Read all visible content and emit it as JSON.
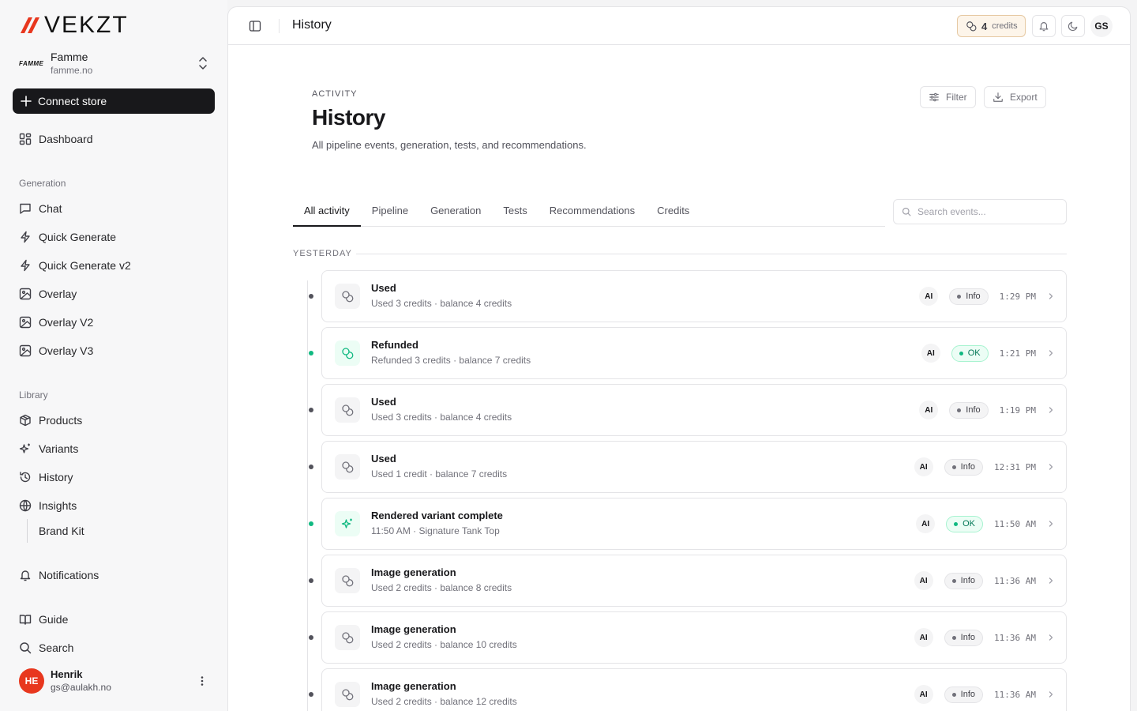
{
  "brand": {
    "name": "VEKZT",
    "accent": "#e8371e"
  },
  "store": {
    "logo_text": "FAMME",
    "name": "Famme",
    "domain": "famme.no"
  },
  "connect_label": "Connect store",
  "nav": {
    "dashboard": "Dashboard",
    "generation_label": "Generation",
    "chat": "Chat",
    "quick_generate": "Quick Generate",
    "quick_generate_v2": "Quick Generate v2",
    "overlay": "Overlay",
    "overlay_v2": "Overlay V2",
    "overlay_v3": "Overlay V3",
    "library_label": "Library",
    "products": "Products",
    "variants": "Variants",
    "history": "History",
    "insights": "Insights",
    "brand_kit": "Brand Kit",
    "notifications": "Notifications",
    "guide": "Guide",
    "search": "Search"
  },
  "user": {
    "initials": "HE",
    "name": "Henrik",
    "email": "gs@aulakh.no"
  },
  "topbar": {
    "title": "History",
    "credits_count": "4",
    "credits_word": "credits",
    "avatar_initials": "GS"
  },
  "page": {
    "eyebrow": "ACTIVITY",
    "title": "History",
    "description": "All pipeline events, generation, tests, and recommendations.",
    "filter_label": "Filter",
    "export_label": "Export"
  },
  "tabs": [
    "All activity",
    "Pipeline",
    "Generation",
    "Tests",
    "Recommendations",
    "Credits"
  ],
  "search_placeholder": "Search events...",
  "day_label": "YESTERDAY",
  "events": [
    {
      "title": "Used",
      "subtitle": "Used 3 credits · balance 4 credits",
      "badge": "AI",
      "status": "Info",
      "time": "1:29 PM",
      "kind": "credit",
      "ok": false
    },
    {
      "title": "Refunded",
      "subtitle": "Refunded 3 credits · balance 7 credits",
      "badge": "AI",
      "status": "OK",
      "time": "1:21 PM",
      "kind": "credit",
      "ok": true
    },
    {
      "title": "Used",
      "subtitle": "Used 3 credits · balance 4 credits",
      "badge": "AI",
      "status": "Info",
      "time": "1:19 PM",
      "kind": "credit",
      "ok": false
    },
    {
      "title": "Used",
      "subtitle": "Used 1 credit · balance 7 credits",
      "badge": "AI",
      "status": "Info",
      "time": "12:31 PM",
      "kind": "credit",
      "ok": false
    },
    {
      "title": "Rendered variant complete",
      "subtitle": "11:50 AM · Signature Tank Top",
      "badge": "AI",
      "status": "OK",
      "time": "11:50 AM",
      "kind": "sparkle",
      "ok": true
    },
    {
      "title": "Image generation",
      "subtitle": "Used 2 credits · balance 8 credits",
      "badge": "AI",
      "status": "Info",
      "time": "11:36 AM",
      "kind": "credit",
      "ok": false
    },
    {
      "title": "Image generation",
      "subtitle": "Used 2 credits · balance 10 credits",
      "badge": "AI",
      "status": "Info",
      "time": "11:36 AM",
      "kind": "credit",
      "ok": false
    },
    {
      "title": "Image generation",
      "subtitle": "Used 2 credits · balance 12 credits",
      "badge": "AI",
      "status": "Info",
      "time": "11:36 AM",
      "kind": "credit",
      "ok": false
    }
  ]
}
